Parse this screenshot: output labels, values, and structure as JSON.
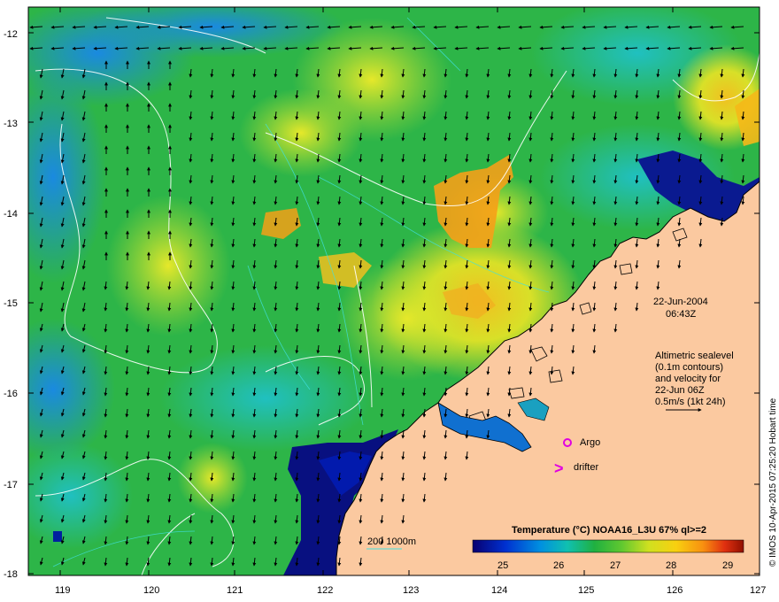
{
  "map": {
    "date": "22-Jun-2004",
    "time": "06:43Z",
    "description_lines": [
      "Altimetric sealevel",
      "(0.1m contours)",
      "and velocity for",
      "22-Jun 06Z",
      "0.5m/s (1kt 24h)"
    ],
    "markers": {
      "argo_label": "Argo",
      "drifter_label": "drifter",
      "drifter_symbol": ">"
    },
    "bathymetry_label": "200  1000m",
    "colorbar": {
      "title": "Temperature (°C) NOAA16_L3U 67% ql>=2",
      "ticks": [
        "25",
        "26",
        "27",
        "28",
        "29"
      ]
    },
    "credit": "© IMOS 10-Apr-2015 07:25:20 Hobart time",
    "lon_ticks": [
      "119",
      "120",
      "121",
      "122",
      "123",
      "124",
      "125",
      "126",
      "127"
    ],
    "lat_ticks": [
      "-12",
      "-13",
      "-14",
      "-15",
      "-16",
      "-17",
      "-18"
    ],
    "colors": {
      "land": "#fbc9a0",
      "sst_cold": "#0a1a7a",
      "sst_mid": "#22b14c",
      "sst_warm": "#e8e020",
      "sst_hot": "#ff9a1a",
      "argo": "#e000e0",
      "drifter": "#e000e0",
      "contour": "#ffffff",
      "bathy": "#40e0e0"
    }
  }
}
